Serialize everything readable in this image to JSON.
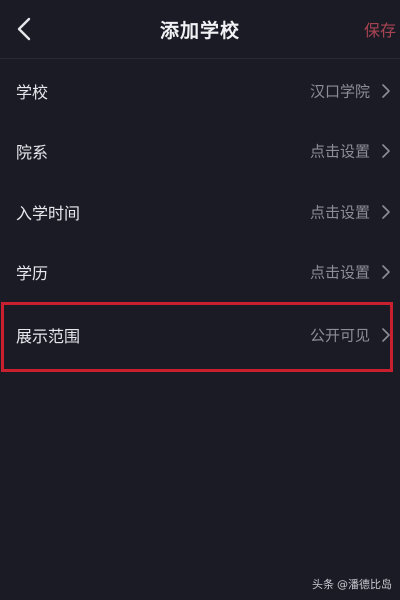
{
  "header": {
    "title": "添加学校",
    "save_label": "保存",
    "back_icon": "chevron-left-icon"
  },
  "rows": [
    {
      "label": "学校",
      "value": "汉口学院"
    },
    {
      "label": "院系",
      "value": "点击设置"
    },
    {
      "label": "入学时间",
      "value": "点击设置"
    },
    {
      "label": "学历",
      "value": "点击设置"
    },
    {
      "label": "展示范围",
      "value": "公开可见"
    }
  ],
  "watermark": {
    "source": "头条",
    "author": "@潘德比岛"
  },
  "colors": {
    "background": "#1b1b26",
    "save_accent": "#a84452",
    "highlight": "#c8202e",
    "value_text": "#8d8d98"
  }
}
